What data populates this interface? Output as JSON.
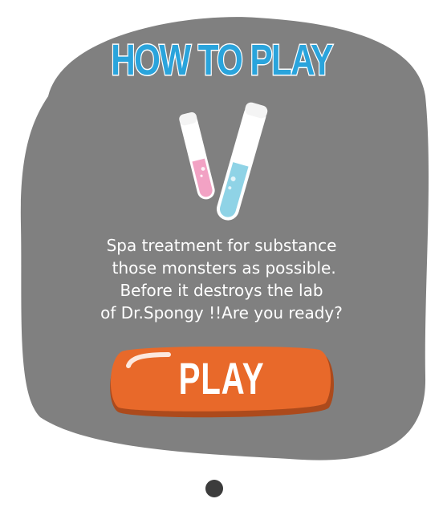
{
  "panel": {
    "title": "HOW TO PLAY",
    "description_lines": [
      "Spa treatment for substance",
      " those monsters as possible.",
      "Before it destroys the lab",
      "of Dr.Spongy !!Are you ready?"
    ]
  },
  "play_button": {
    "label": "PLAY"
  },
  "colors": {
    "panel_bg": "#808080",
    "title": "#2aa4dc",
    "button": "#e8692a",
    "tube_pink": "#f2a2c4",
    "tube_blue": "#8fd3e6",
    "page_dot": "#3c3c3c"
  },
  "icons": [
    "test-tube-pink-icon",
    "test-tube-blue-icon"
  ],
  "pagination": {
    "total": 1,
    "active": 1
  }
}
